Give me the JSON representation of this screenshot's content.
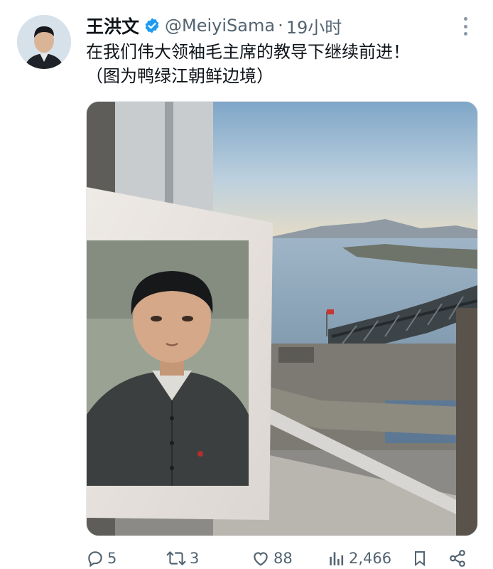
{
  "tweet": {
    "author_name": "王洪文",
    "handle": "@MeiyiSama",
    "separator": "·",
    "time": "19小时",
    "text": "在我们伟大领袖毛主席的教导下继续前进！\n（图为鸭绿江朝鲜边境）",
    "avatar_icon": "person-portrait",
    "verified_icon": "verified-badge-icon",
    "media_description_icon": "photo"
  },
  "actions": {
    "replies": "5",
    "retweets": "3",
    "likes": "88",
    "views": "2,466"
  },
  "colors": {
    "text": "#0f1419",
    "secondary": "#536471",
    "verified": "#1d9bf0"
  }
}
